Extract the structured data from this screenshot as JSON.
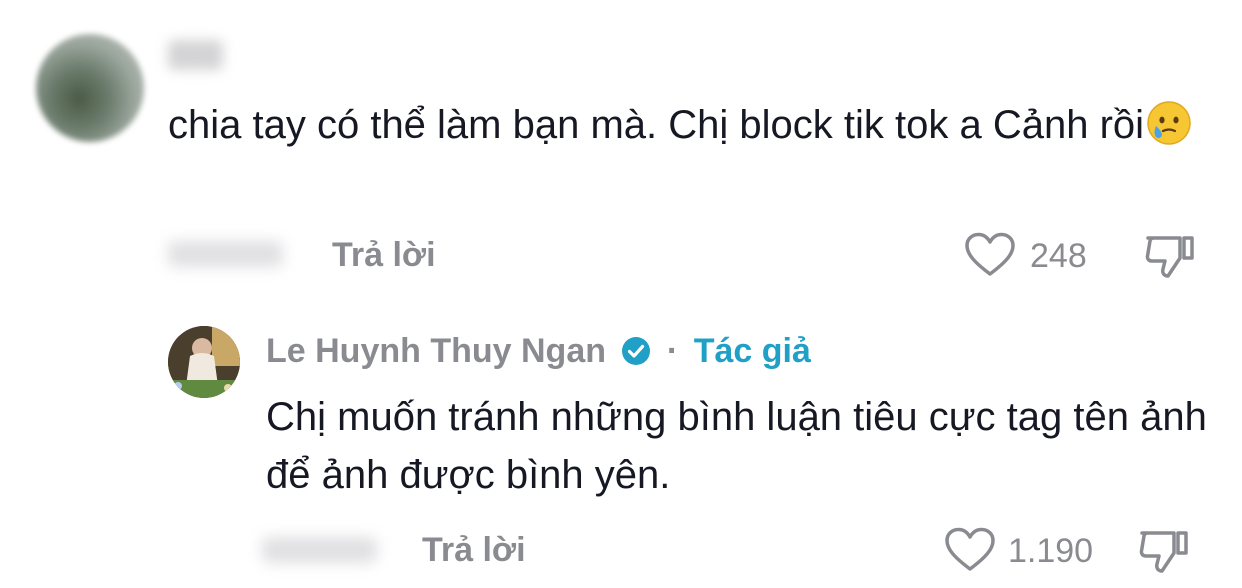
{
  "comment": {
    "text": "chia tay có thể làm bạn mà. Chị block tik tok a Cảnh rồi",
    "emoji": "crying-face-emoji",
    "reply_label": "Trả lời",
    "like_count": "248"
  },
  "reply": {
    "author": "Le Huynh Thuy Ngan",
    "separator": "·",
    "author_tag": "Tác giả",
    "text": "Chị muốn tránh những bình luận tiêu cực tag tên ảnh để ảnh được bình yên.",
    "reply_label": "Trả lời",
    "like_count": "1.190"
  },
  "colors": {
    "text_primary": "#161823",
    "text_secondary": "#8a8b91",
    "verified_badge": "#20a0c6",
    "author_tag": "#20a0c6"
  }
}
